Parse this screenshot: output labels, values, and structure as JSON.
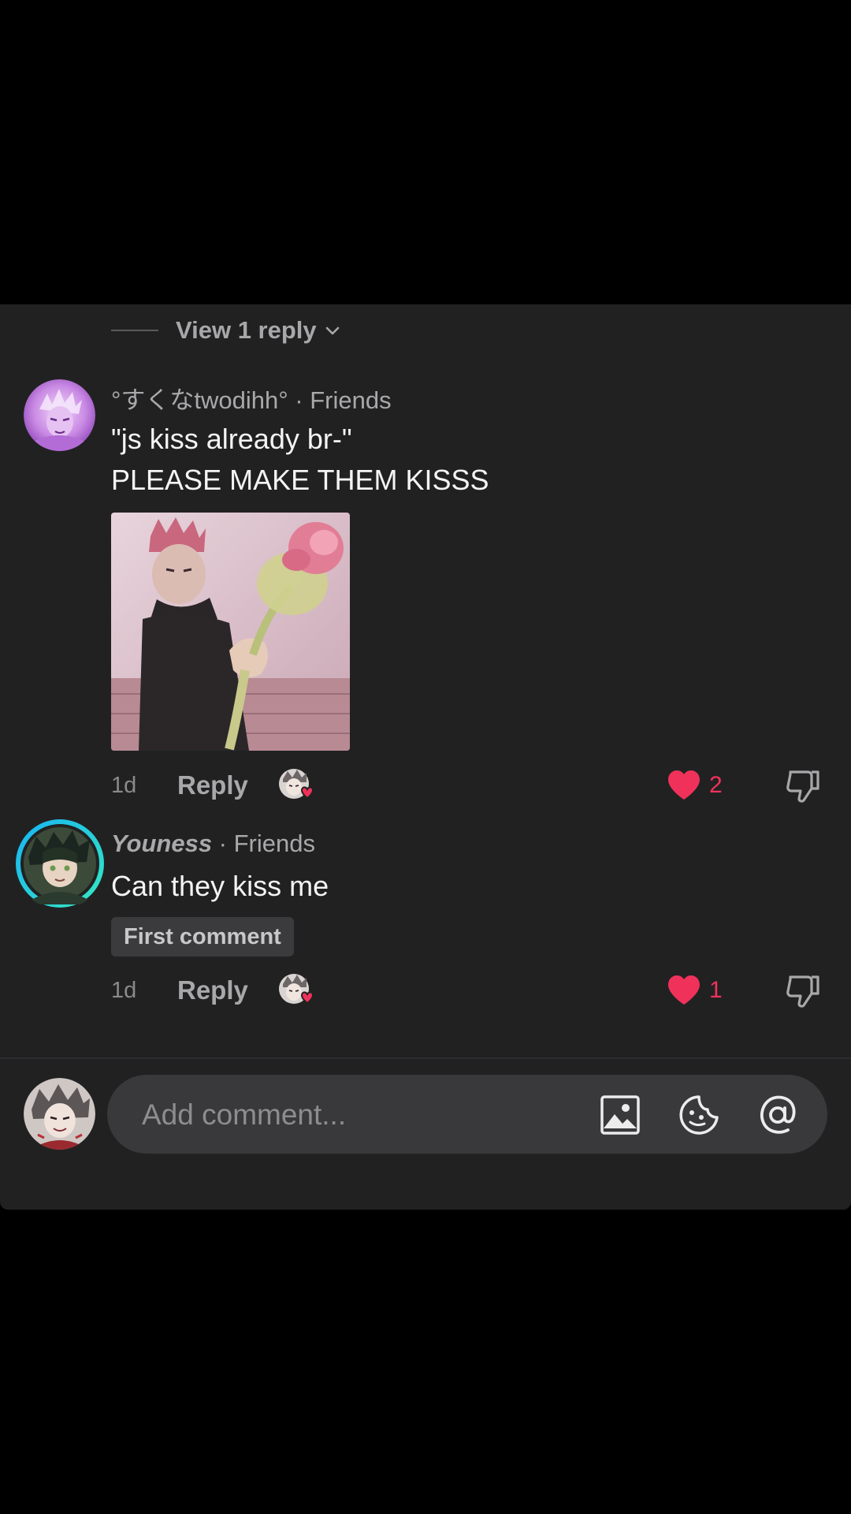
{
  "thread": {
    "view_replies_label": "View 1 reply"
  },
  "comments": [
    {
      "username": "°すくなtwodihh°",
      "relation": " · Friends",
      "lines": [
        "\"js kiss already br-\"",
        "PLEASE MAKE THEM KISSS"
      ],
      "time": "1d",
      "reply_label": "Reply",
      "likes": "2",
      "has_image": true
    },
    {
      "username": "Youness",
      "relation": " · Friends",
      "lines": [
        "Can they kiss me"
      ],
      "badge": "First comment",
      "time": "1d",
      "reply_label": "Reply",
      "likes": "1"
    }
  ],
  "composer": {
    "placeholder": "Add comment..."
  },
  "colors": {
    "background": "#212122",
    "like": "#f0325a",
    "text_muted": "#a8a8aa"
  },
  "icons": {
    "view_replies": "chevron-down-icon",
    "like": "heart-icon",
    "dislike": "thumbs-down-icon",
    "creator_liked": "creator-liked-icon",
    "image": "image-icon",
    "emoji": "emoji-sticker-icon",
    "mention": "at-mention-icon"
  }
}
